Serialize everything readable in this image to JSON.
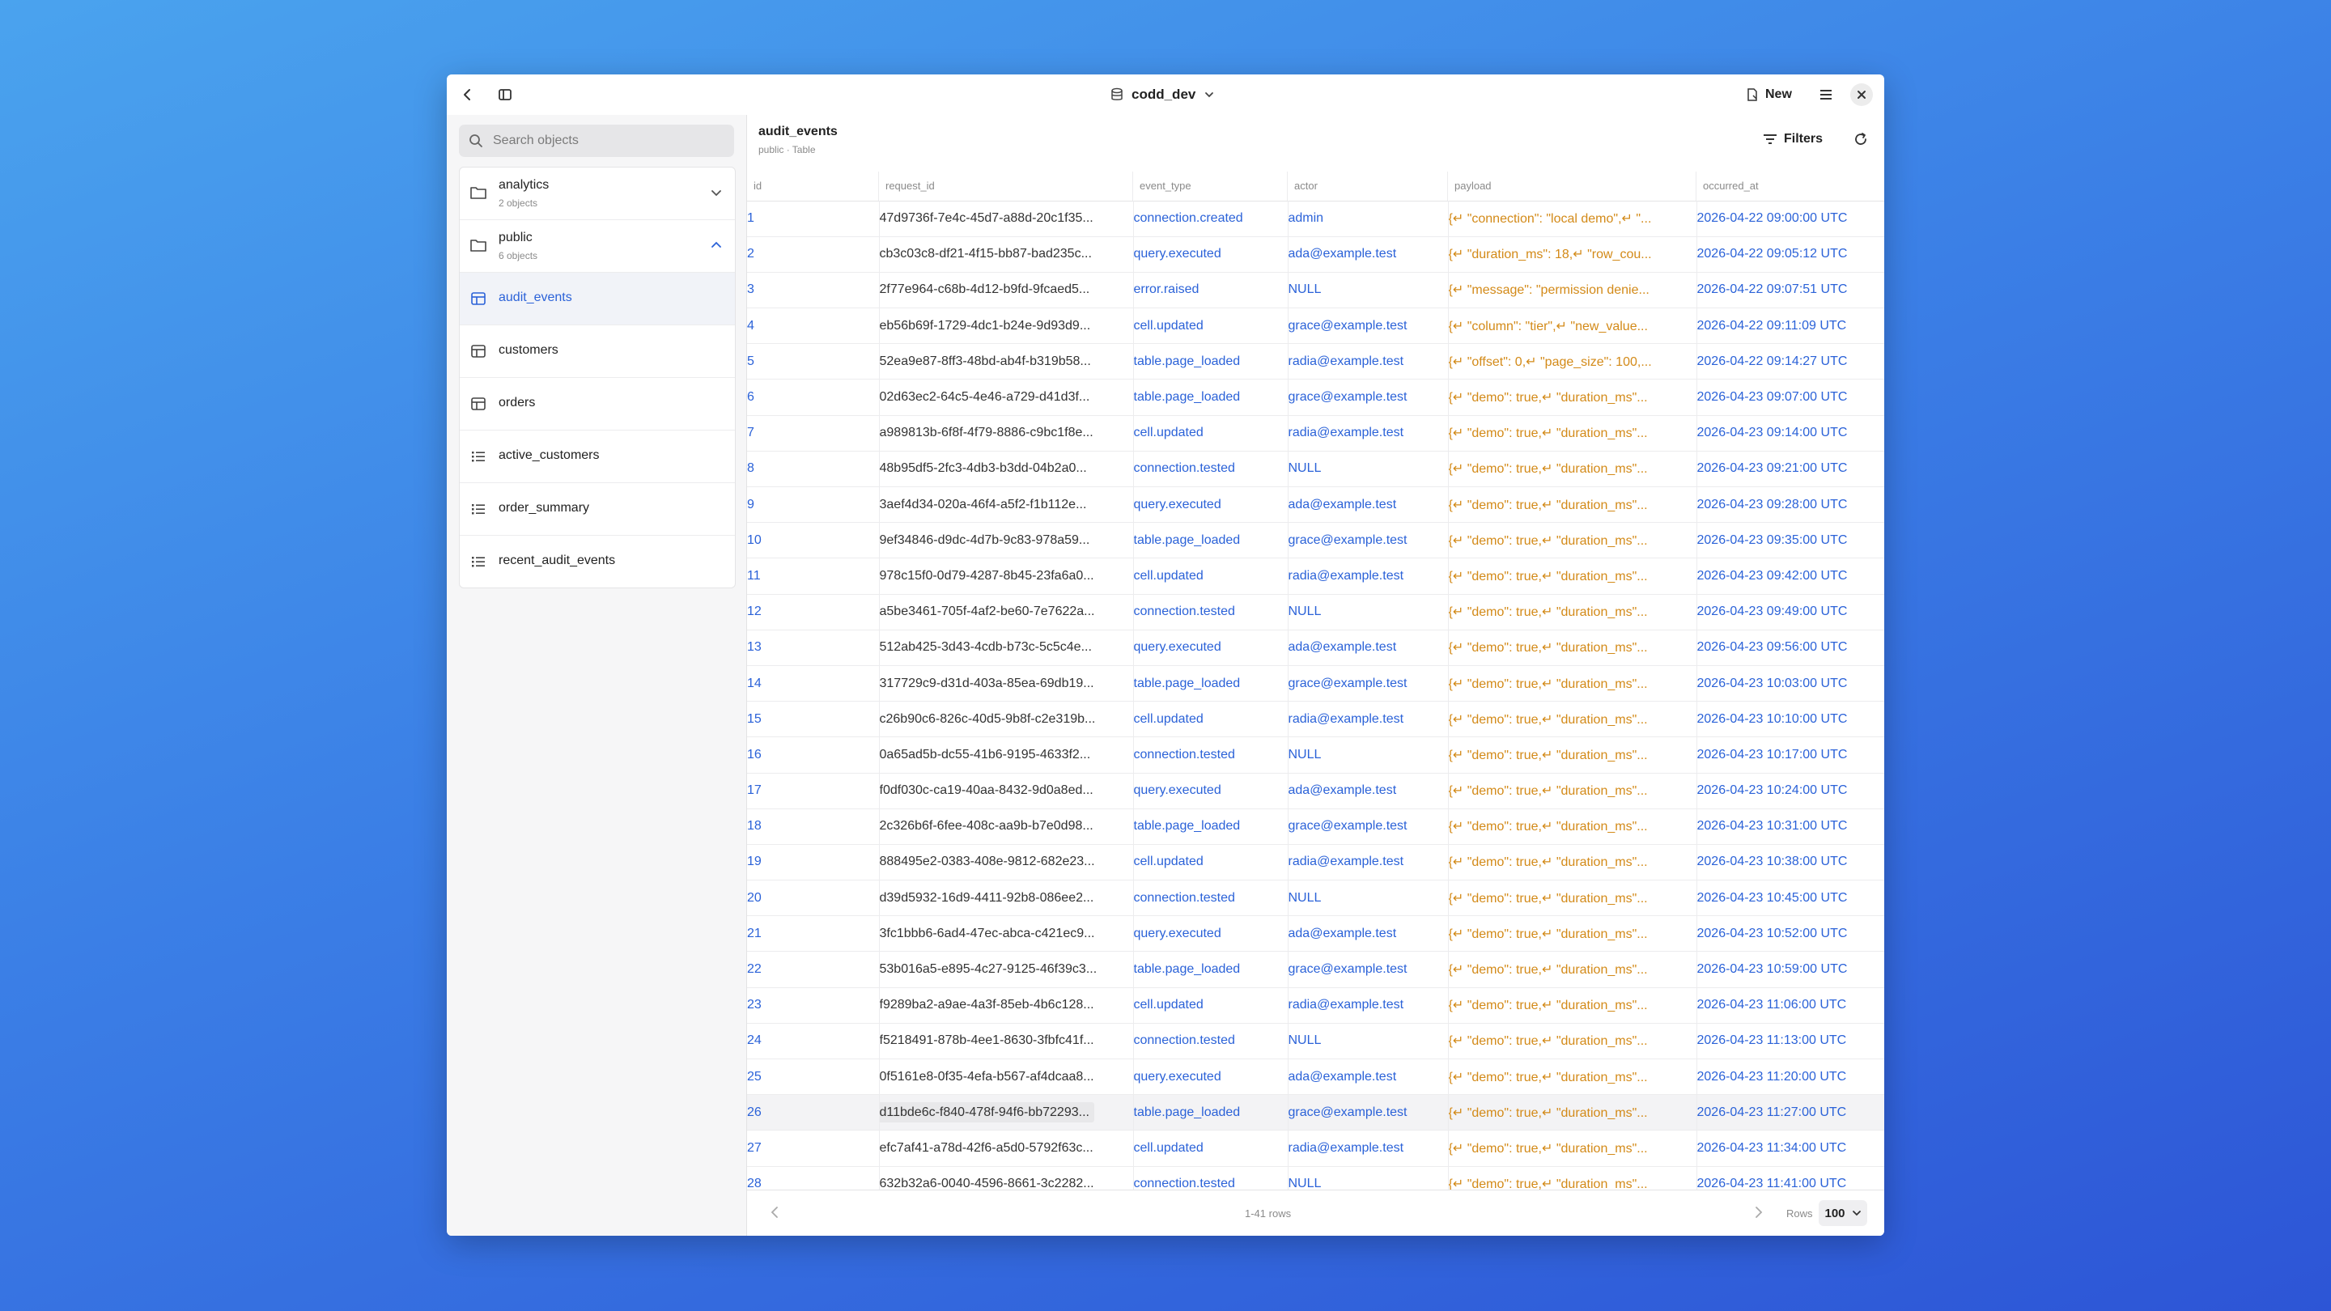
{
  "titlebar": {
    "database": "codd_dev",
    "new_label": "New"
  },
  "sidebar": {
    "search_placeholder": "Search objects",
    "schemas": [
      {
        "name": "analytics",
        "count": "2 objects",
        "expanded": false
      },
      {
        "name": "public",
        "count": "6 objects",
        "expanded": true
      }
    ],
    "objects": [
      {
        "name": "audit_events",
        "kind": "table",
        "active": true
      },
      {
        "name": "customers",
        "kind": "table"
      },
      {
        "name": "orders",
        "kind": "table"
      },
      {
        "name": "active_customers",
        "kind": "view"
      },
      {
        "name": "order_summary",
        "kind": "view"
      },
      {
        "name": "recent_audit_events",
        "kind": "view"
      }
    ]
  },
  "header": {
    "table_name": "audit_events",
    "subtitle": "public · Table",
    "filters_label": "Filters"
  },
  "columns": [
    "id",
    "request_id",
    "event_type",
    "actor",
    "payload",
    "occurred_at"
  ],
  "rows": [
    {
      "id": "1",
      "request_id": "47d9736f-7e4c-45d7-a88d-20c1f35...",
      "event_type": "connection.created",
      "actor": "admin",
      "payload": "{↵ \"connection\": \"local demo\",↵ \"...",
      "occurred_at": "2026-04-22 09:00:00 UTC"
    },
    {
      "id": "2",
      "request_id": "cb3c03c8-df21-4f15-bb87-bad235c...",
      "event_type": "query.executed",
      "actor": "ada@example.test",
      "payload": "{↵ \"duration_ms\": 18,↵ \"row_cou...",
      "occurred_at": "2026-04-22 09:05:12 UTC"
    },
    {
      "id": "3",
      "request_id": "2f77e964-c68b-4d12-b9fd-9fcaed5...",
      "event_type": "error.raised",
      "actor": "NULL",
      "payload": "{↵ \"message\": \"permission denie...",
      "occurred_at": "2026-04-22 09:07:51 UTC"
    },
    {
      "id": "4",
      "request_id": "eb56b69f-1729-4dc1-b24e-9d93d9...",
      "event_type": "cell.updated",
      "actor": "grace@example.test",
      "payload": "{↵ \"column\": \"tier\",↵ \"new_value...",
      "occurred_at": "2026-04-22 09:11:09 UTC"
    },
    {
      "id": "5",
      "request_id": "52ea9e87-8ff3-48bd-ab4f-b319b58...",
      "event_type": "table.page_loaded",
      "actor": "radia@example.test",
      "payload": "{↵ \"offset\": 0,↵ \"page_size\": 100,...",
      "occurred_at": "2026-04-22 09:14:27 UTC"
    },
    {
      "id": "6",
      "request_id": "02d63ec2-64c5-4e46-a729-d41d3f...",
      "event_type": "table.page_loaded",
      "actor": "grace@example.test",
      "payload": "{↵ \"demo\": true,↵ \"duration_ms\"...",
      "occurred_at": "2026-04-23 09:07:00 UTC"
    },
    {
      "id": "7",
      "request_id": "a989813b-6f8f-4f79-8886-c9bc1f8e...",
      "event_type": "cell.updated",
      "actor": "radia@example.test",
      "payload": "{↵ \"demo\": true,↵ \"duration_ms\"...",
      "occurred_at": "2026-04-23 09:14:00 UTC"
    },
    {
      "id": "8",
      "request_id": "48b95df5-2fc3-4db3-b3dd-04b2a0...",
      "event_type": "connection.tested",
      "actor": "NULL",
      "payload": "{↵ \"demo\": true,↵ \"duration_ms\"...",
      "occurred_at": "2026-04-23 09:21:00 UTC"
    },
    {
      "id": "9",
      "request_id": "3aef4d34-020a-46f4-a5f2-f1b112e...",
      "event_type": "query.executed",
      "actor": "ada@example.test",
      "payload": "{↵ \"demo\": true,↵ \"duration_ms\"...",
      "occurred_at": "2026-04-23 09:28:00 UTC"
    },
    {
      "id": "10",
      "request_id": "9ef34846-d9dc-4d7b-9c83-978a59...",
      "event_type": "table.page_loaded",
      "actor": "grace@example.test",
      "payload": "{↵ \"demo\": true,↵ \"duration_ms\"...",
      "occurred_at": "2026-04-23 09:35:00 UTC"
    },
    {
      "id": "11",
      "request_id": "978c15f0-0d79-4287-8b45-23fa6a0...",
      "event_type": "cell.updated",
      "actor": "radia@example.test",
      "payload": "{↵ \"demo\": true,↵ \"duration_ms\"...",
      "occurred_at": "2026-04-23 09:42:00 UTC"
    },
    {
      "id": "12",
      "request_id": "a5be3461-705f-4af2-be60-7e7622a...",
      "event_type": "connection.tested",
      "actor": "NULL",
      "payload": "{↵ \"demo\": true,↵ \"duration_ms\"...",
      "occurred_at": "2026-04-23 09:49:00 UTC"
    },
    {
      "id": "13",
      "request_id": "512ab425-3d43-4cdb-b73c-5c5c4e...",
      "event_type": "query.executed",
      "actor": "ada@example.test",
      "payload": "{↵ \"demo\": true,↵ \"duration_ms\"...",
      "occurred_at": "2026-04-23 09:56:00 UTC"
    },
    {
      "id": "14",
      "request_id": "317729c9-d31d-403a-85ea-69db19...",
      "event_type": "table.page_loaded",
      "actor": "grace@example.test",
      "payload": "{↵ \"demo\": true,↵ \"duration_ms\"...",
      "occurred_at": "2026-04-23 10:03:00 UTC"
    },
    {
      "id": "15",
      "request_id": "c26b90c6-826c-40d5-9b8f-c2e319b...",
      "event_type": "cell.updated",
      "actor": "radia@example.test",
      "payload": "{↵ \"demo\": true,↵ \"duration_ms\"...",
      "occurred_at": "2026-04-23 10:10:00 UTC"
    },
    {
      "id": "16",
      "request_id": "0a65ad5b-dc55-41b6-9195-4633f2...",
      "event_type": "connection.tested",
      "actor": "NULL",
      "payload": "{↵ \"demo\": true,↵ \"duration_ms\"...",
      "occurred_at": "2026-04-23 10:17:00 UTC"
    },
    {
      "id": "17",
      "request_id": "f0df030c-ca19-40aa-8432-9d0a8ed...",
      "event_type": "query.executed",
      "actor": "ada@example.test",
      "payload": "{↵ \"demo\": true,↵ \"duration_ms\"...",
      "occurred_at": "2026-04-23 10:24:00 UTC"
    },
    {
      "id": "18",
      "request_id": "2c326b6f-6fee-408c-aa9b-b7e0d98...",
      "event_type": "table.page_loaded",
      "actor": "grace@example.test",
      "payload": "{↵ \"demo\": true,↵ \"duration_ms\"...",
      "occurred_at": "2026-04-23 10:31:00 UTC"
    },
    {
      "id": "19",
      "request_id": "888495e2-0383-408e-9812-682e23...",
      "event_type": "cell.updated",
      "actor": "radia@example.test",
      "payload": "{↵ \"demo\": true,↵ \"duration_ms\"...",
      "occurred_at": "2026-04-23 10:38:00 UTC"
    },
    {
      "id": "20",
      "request_id": "d39d5932-16d9-4411-92b8-086ee2...",
      "event_type": "connection.tested",
      "actor": "NULL",
      "payload": "{↵ \"demo\": true,↵ \"duration_ms\"...",
      "occurred_at": "2026-04-23 10:45:00 UTC"
    },
    {
      "id": "21",
      "request_id": "3fc1bbb6-6ad4-47ec-abca-c421ec9...",
      "event_type": "query.executed",
      "actor": "ada@example.test",
      "payload": "{↵ \"demo\": true,↵ \"duration_ms\"...",
      "occurred_at": "2026-04-23 10:52:00 UTC"
    },
    {
      "id": "22",
      "request_id": "53b016a5-e895-4c27-9125-46f39c3...",
      "event_type": "table.page_loaded",
      "actor": "grace@example.test",
      "payload": "{↵ \"demo\": true,↵ \"duration_ms\"...",
      "occurred_at": "2026-04-23 10:59:00 UTC"
    },
    {
      "id": "23",
      "request_id": "f9289ba2-a9ae-4a3f-85eb-4b6c128...",
      "event_type": "cell.updated",
      "actor": "radia@example.test",
      "payload": "{↵ \"demo\": true,↵ \"duration_ms\"...",
      "occurred_at": "2026-04-23 11:06:00 UTC"
    },
    {
      "id": "24",
      "request_id": "f5218491-878b-4ee1-8630-3fbfc41f...",
      "event_type": "connection.tested",
      "actor": "NULL",
      "payload": "{↵ \"demo\": true,↵ \"duration_ms\"...",
      "occurred_at": "2026-04-23 11:13:00 UTC"
    },
    {
      "id": "25",
      "request_id": "0f5161e8-0f35-4efa-b567-af4dcaa8...",
      "event_type": "query.executed",
      "actor": "ada@example.test",
      "payload": "{↵ \"demo\": true,↵ \"duration_ms\"...",
      "occurred_at": "2026-04-23 11:20:00 UTC"
    },
    {
      "id": "26",
      "request_id": "d11bde6c-f840-478f-94f6-bb72293...",
      "event_type": "table.page_loaded",
      "actor": "grace@example.test",
      "payload": "{↵ \"demo\": true,↵ \"duration_ms\"...",
      "occurred_at": "2026-04-23 11:27:00 UTC",
      "highlighted": true
    },
    {
      "id": "27",
      "request_id": "efc7af41-a78d-42f6-a5d0-5792f63c...",
      "event_type": "cell.updated",
      "actor": "radia@example.test",
      "payload": "{↵ \"demo\": true,↵ \"duration_ms\"...",
      "occurred_at": "2026-04-23 11:34:00 UTC"
    },
    {
      "id": "28",
      "request_id": "632b32a6-0040-4596-8661-3c2282...",
      "event_type": "connection.tested",
      "actor": "NULL",
      "payload": "{↵ \"demo\": true,↵ \"duration_ms\"...",
      "occurred_at": "2026-04-23 11:41:00 UTC"
    }
  ],
  "footer": {
    "row_count": "1-41 rows",
    "rows_label": "Rows",
    "page_size": "100"
  },
  "colors": {
    "accent": "#2b62d8",
    "payload": "#d38a18",
    "background_top": "#4aa3ee",
    "background_bottom": "#2d55d6"
  }
}
